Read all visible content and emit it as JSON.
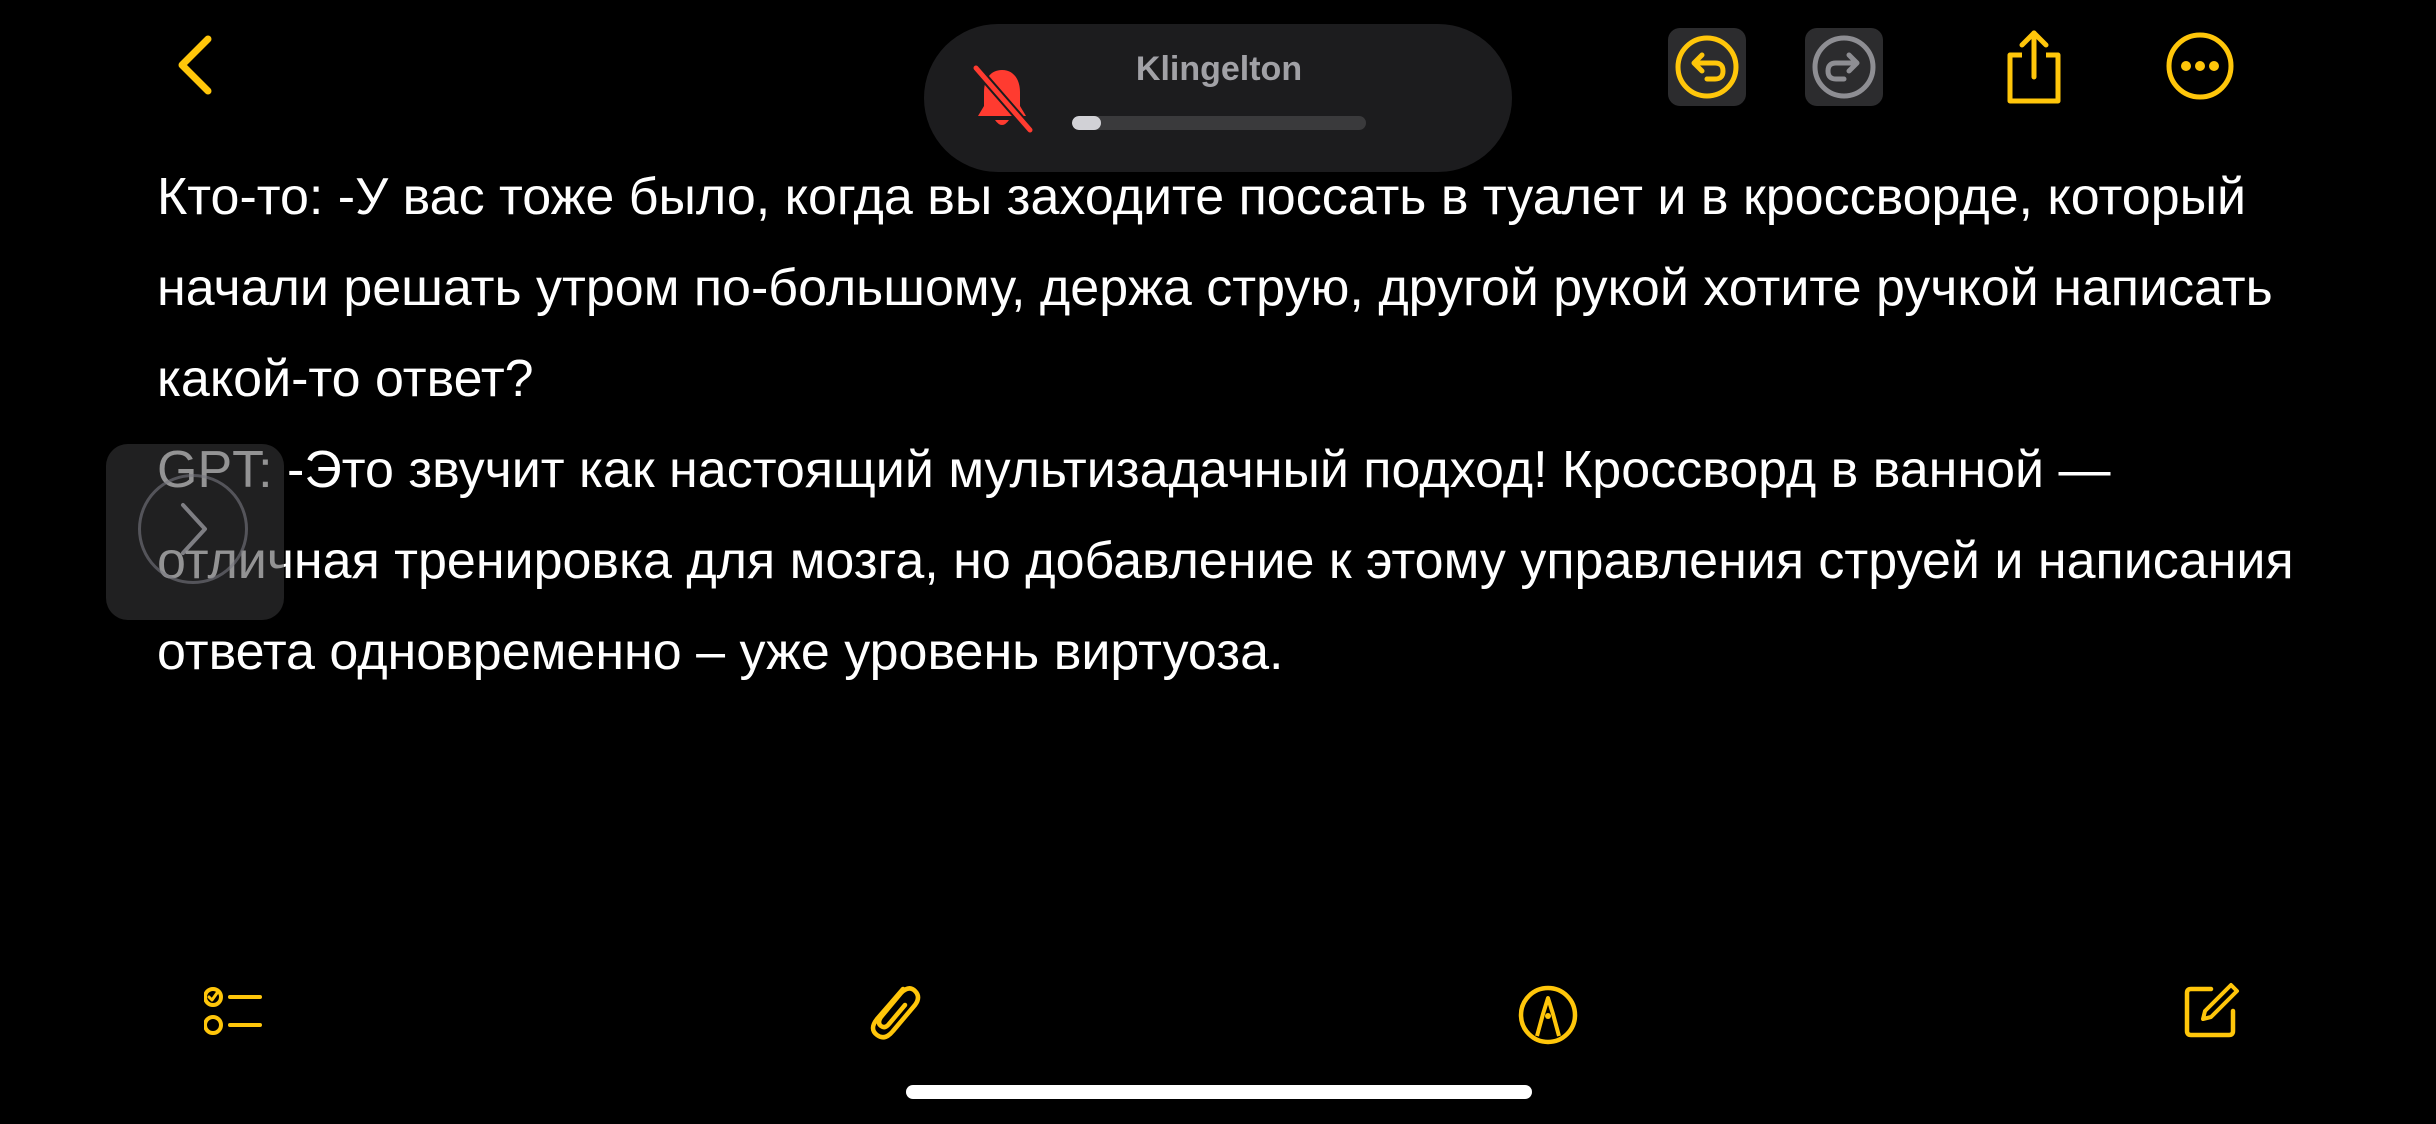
{
  "colors": {
    "accent": "#ffc60a",
    "background": "#000000",
    "muted_icon": "#8e8e93",
    "ringer_mute_icon": "#ff3b30"
  },
  "top_bar": {
    "back_icon": "chevron-left-icon",
    "undo_icon": "undo-icon",
    "redo_icon": "redo-icon",
    "share_icon": "share-icon",
    "more_icon": "ellipsis-circle-icon"
  },
  "ringer_hud": {
    "label": "Klingelton",
    "icon": "bell-slash-icon",
    "volume_fraction": 0.1
  },
  "note": {
    "paragraphs": [
      "Кто-то: -У вас тоже было, когда вы заходите поссать в туалет и в кроссворде, который начали решать утром по-большому, держа струю, другой рукой хотите ручкой написать какой-то ответ?",
      "GPT: -Это звучит как настоящий мультизадачный подход! Кроссворд в ванной — отличная тренировка для мозга, но добавление к этому управления струей и написания ответа одновременно – уже уровень виртуоза."
    ]
  },
  "side_tab": {
    "icon": "chevron-right-icon"
  },
  "bottom_toolbar": {
    "checklist_icon": "checklist-icon",
    "attach_icon": "paperclip-icon",
    "markup_icon": "pen-tip-circle-icon",
    "compose_icon": "compose-icon"
  }
}
